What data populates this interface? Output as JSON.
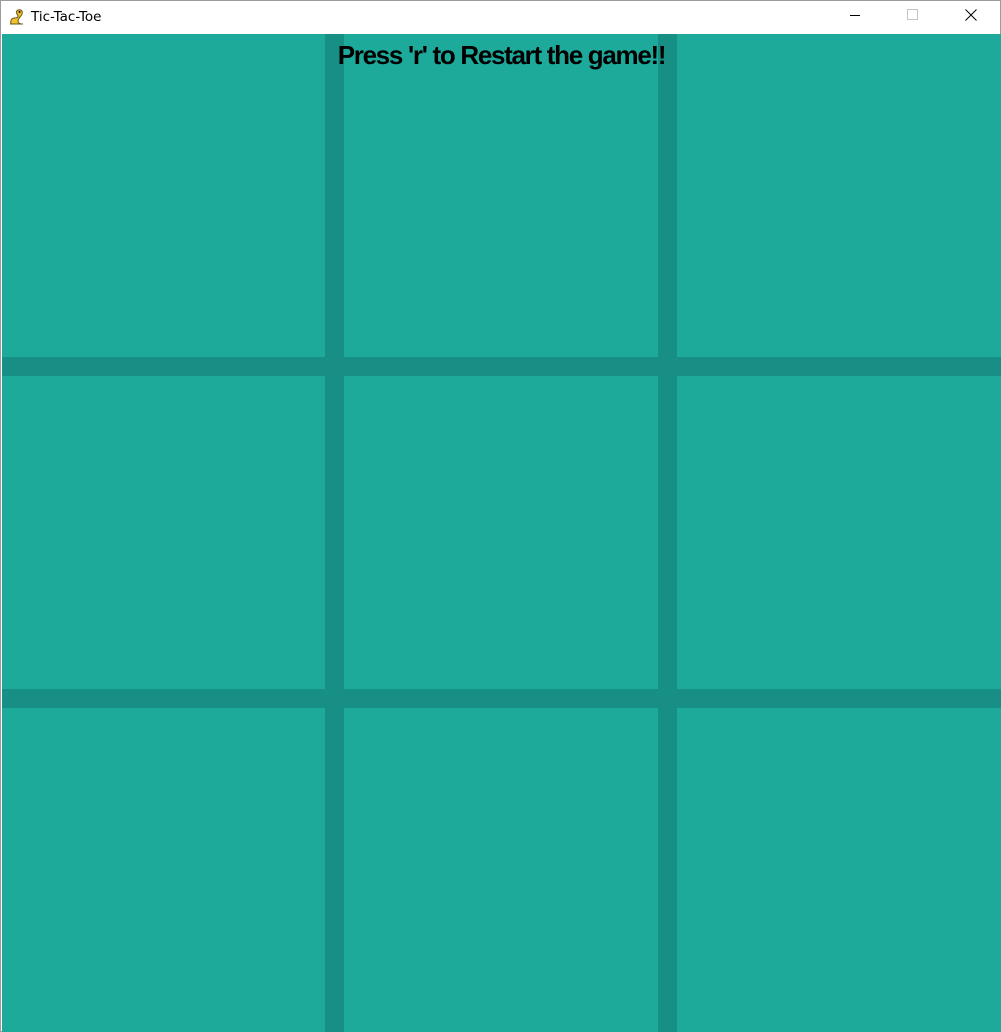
{
  "window": {
    "title": "Tic-Tac-Toe",
    "app_icon": "pygame-snake-icon",
    "controls": [
      "minimize-icon",
      "maximize-icon",
      "close-icon"
    ]
  },
  "game": {
    "message": "Press 'r' to Restart the game!!",
    "board": [
      [
        "",
        "",
        ""
      ],
      [
        "",
        "",
        ""
      ],
      [
        "",
        "",
        ""
      ]
    ]
  },
  "colors": {
    "board_background": "#1daa9b",
    "grid_line": "#178f85",
    "message_text": "#000000"
  }
}
